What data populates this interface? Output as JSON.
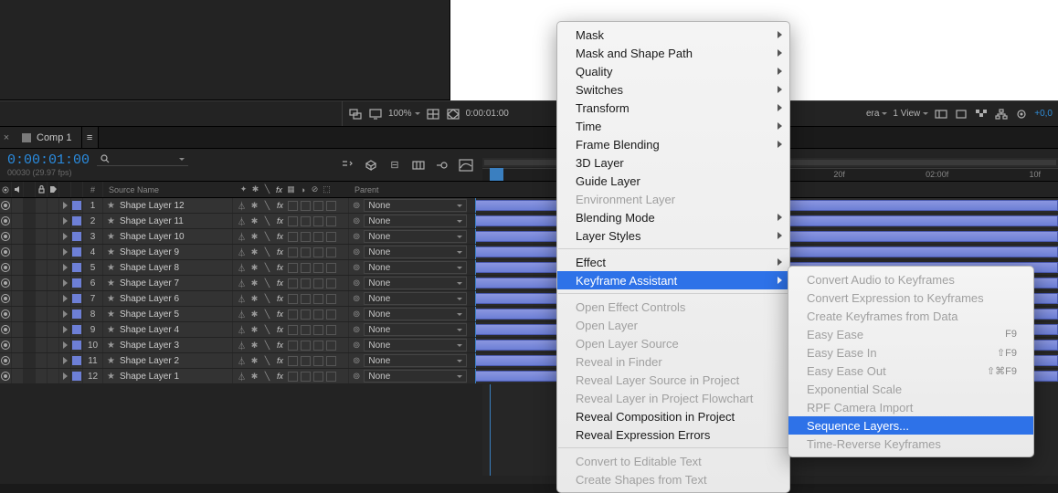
{
  "viewer_toolbar": {
    "zoom": "100%",
    "timecode": "0:00:01:00",
    "camera": "era",
    "views": "1 View",
    "exposure": "+0,0"
  },
  "timeline": {
    "tab_name": "Comp 1",
    "current_time": "0:00:01:00",
    "frame_info": "00030 (29.97 fps)",
    "search_placeholder": "",
    "col_index": "#",
    "col_source": "Source Name",
    "col_parent": "Parent",
    "parent_default": "None",
    "ruler": [
      "10f",
      "20f",
      "02:00f",
      "10f"
    ],
    "ruler_pos": [
      45,
      62,
      79,
      96
    ],
    "layers": [
      {
        "idx": "1",
        "name": "Shape Layer 12"
      },
      {
        "idx": "2",
        "name": "Shape Layer 11"
      },
      {
        "idx": "3",
        "name": "Shape Layer 10"
      },
      {
        "idx": "4",
        "name": "Shape Layer 9"
      },
      {
        "idx": "5",
        "name": "Shape Layer 8"
      },
      {
        "idx": "6",
        "name": "Shape Layer 7"
      },
      {
        "idx": "7",
        "name": "Shape Layer 6"
      },
      {
        "idx": "8",
        "name": "Shape Layer 5"
      },
      {
        "idx": "9",
        "name": "Shape Layer 4"
      },
      {
        "idx": "10",
        "name": "Shape Layer 3"
      },
      {
        "idx": "11",
        "name": "Shape Layer 2"
      },
      {
        "idx": "12",
        "name": "Shape Layer 1"
      }
    ]
  },
  "menu_main": [
    {
      "label": "Mask",
      "sub": true
    },
    {
      "label": "Mask and Shape Path",
      "sub": true
    },
    {
      "label": "Quality",
      "sub": true
    },
    {
      "label": "Switches",
      "sub": true
    },
    {
      "label": "Transform",
      "sub": true
    },
    {
      "label": "Time",
      "sub": true
    },
    {
      "label": "Frame Blending",
      "sub": true
    },
    {
      "label": "3D Layer"
    },
    {
      "label": "Guide Layer"
    },
    {
      "label": "Environment Layer",
      "disabled": true
    },
    {
      "label": "Blending Mode",
      "sub": true
    },
    {
      "label": "Layer Styles",
      "sub": true
    },
    {
      "sep": true
    },
    {
      "label": "Effect",
      "sub": true
    },
    {
      "label": "Keyframe Assistant",
      "sub": true,
      "hl": true
    },
    {
      "sep": true
    },
    {
      "label": "Open Effect Controls",
      "disabled": true
    },
    {
      "label": "Open Layer",
      "disabled": true
    },
    {
      "label": "Open Layer Source",
      "disabled": true
    },
    {
      "label": "Reveal in Finder",
      "disabled": true
    },
    {
      "label": "Reveal Layer Source in Project",
      "disabled": true
    },
    {
      "label": "Reveal Layer in Project Flowchart",
      "disabled": true
    },
    {
      "label": "Reveal Composition in Project"
    },
    {
      "label": "Reveal Expression Errors"
    },
    {
      "sep": true
    },
    {
      "label": "Convert to Editable Text",
      "disabled": true
    },
    {
      "label": "Create Shapes from Text",
      "disabled": true
    }
  ],
  "menu_sub": [
    {
      "label": "Convert Audio to Keyframes",
      "disabled": true
    },
    {
      "label": "Convert Expression to Keyframes",
      "disabled": true
    },
    {
      "label": "Create Keyframes from Data",
      "disabled": true
    },
    {
      "label": "Easy Ease",
      "disabled": true,
      "sc": "F9"
    },
    {
      "label": "Easy Ease In",
      "disabled": true,
      "sc": "⇧F9"
    },
    {
      "label": "Easy Ease Out",
      "disabled": true,
      "sc": "⇧⌘F9"
    },
    {
      "label": "Exponential Scale",
      "disabled": true
    },
    {
      "label": "RPF Camera Import",
      "disabled": true
    },
    {
      "label": "Sequence Layers...",
      "hl": true
    },
    {
      "label": "Time-Reverse Keyframes",
      "disabled": true
    }
  ]
}
